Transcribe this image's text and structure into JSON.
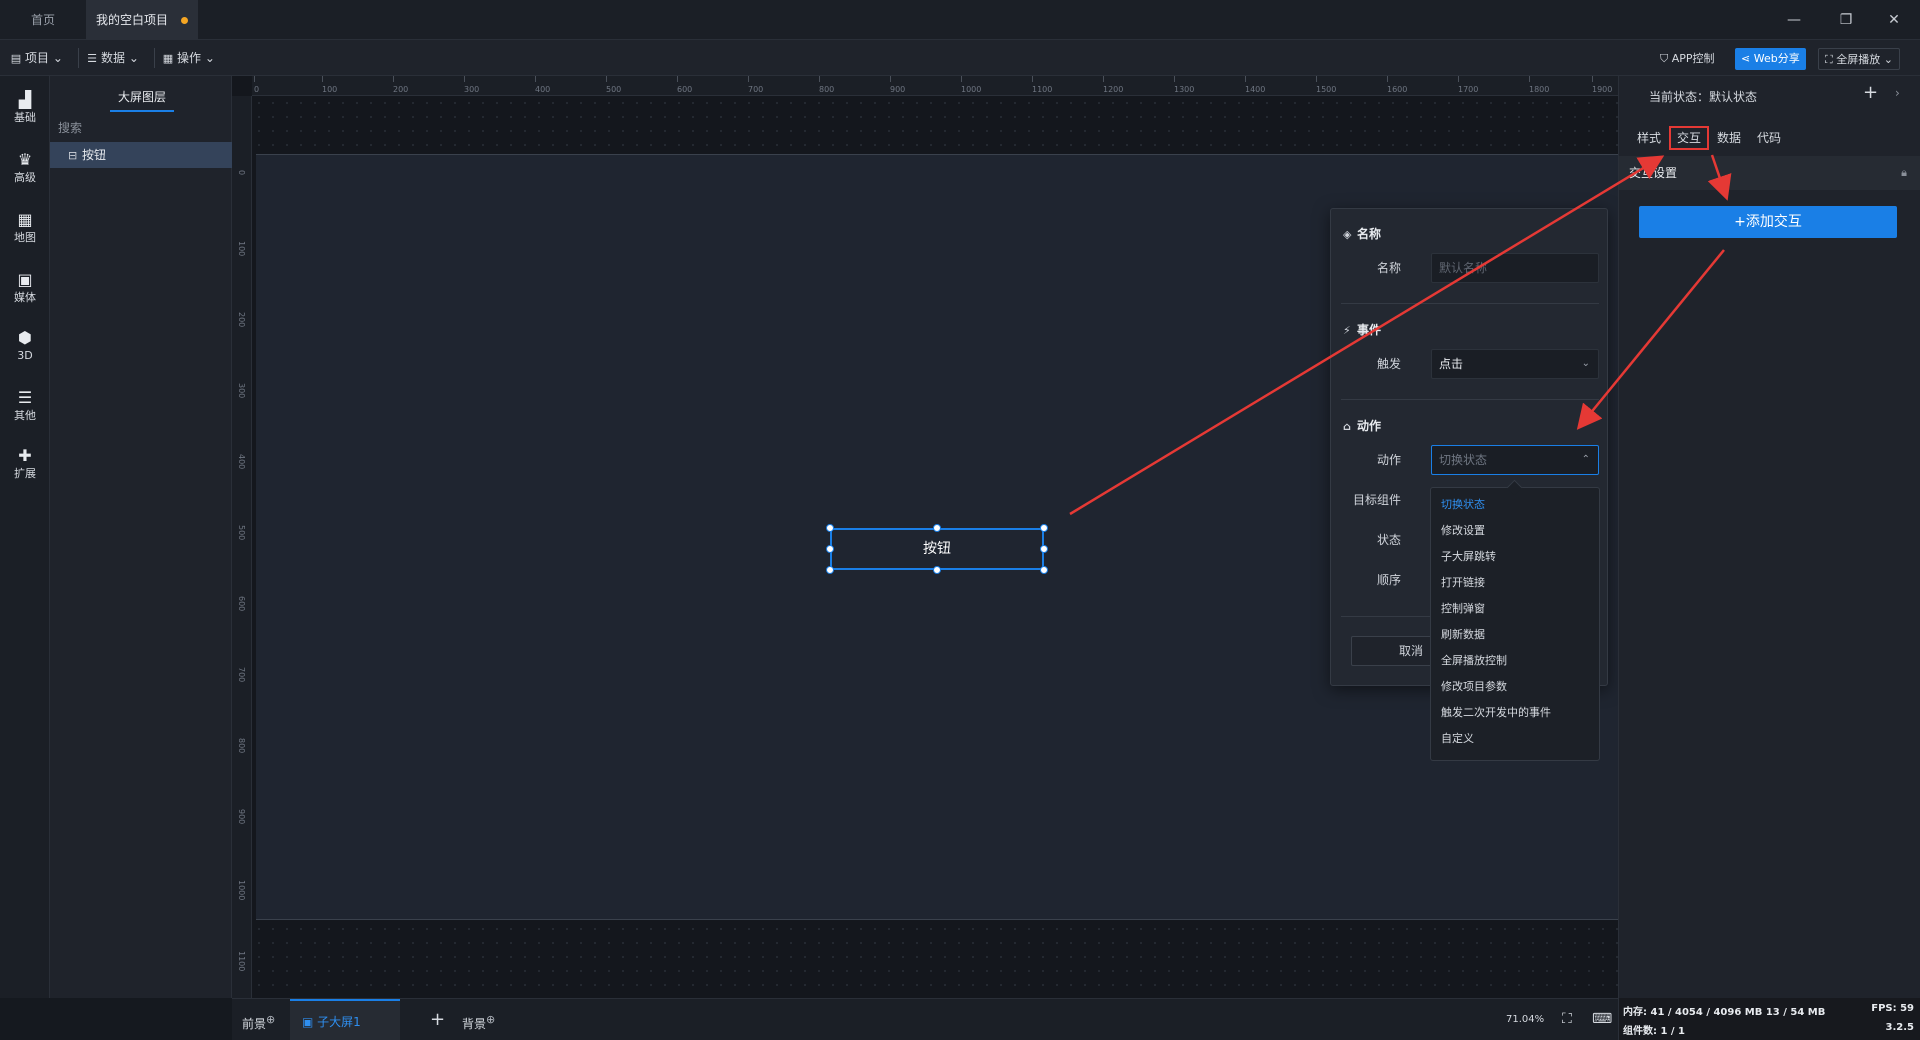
{
  "titlebar": {
    "home_tab": "首页",
    "project_tab": "我的空白项目",
    "minimize": "—",
    "restore": "❐",
    "close": "✕"
  },
  "toolbar": {
    "menus": [
      {
        "label": "项目",
        "icon": "file-icon"
      },
      {
        "label": "数据",
        "icon": "database-icon"
      },
      {
        "label": "操作",
        "icon": "grid-icon"
      }
    ],
    "app_control": "APP控制",
    "web_share": "Web分享",
    "fullscreen": "全屏播放"
  },
  "rail": [
    {
      "label": "基础",
      "icon": "bar-chart-icon",
      "glyph": "▟"
    },
    {
      "label": "高级",
      "icon": "crown-icon",
      "glyph": "♛"
    },
    {
      "label": "地图",
      "icon": "map-icon",
      "glyph": "▦"
    },
    {
      "label": "媒体",
      "icon": "media-icon",
      "glyph": "▣"
    },
    {
      "label": "3D",
      "icon": "cube-icon",
      "glyph": "⬢"
    },
    {
      "label": "其他",
      "icon": "list-icon",
      "glyph": "☰"
    },
    {
      "label": "扩展",
      "icon": "puzzle-icon",
      "glyph": "✚"
    }
  ],
  "layers": {
    "title": "大屏图层",
    "search": "搜索",
    "items": [
      {
        "label": "按钮",
        "icon": "button-icon"
      }
    ]
  },
  "ruler": {
    "h_ticks": [
      "0",
      "100",
      "200",
      "300",
      "400",
      "500",
      "600",
      "700",
      "800",
      "900",
      "1000",
      "1100",
      "1200",
      "1300",
      "1400",
      "1500",
      "1600",
      "1700",
      "1800",
      "1900"
    ],
    "v_ticks": [
      "0",
      "100",
      "200",
      "300",
      "400",
      "500",
      "600",
      "700",
      "800",
      "900",
      "1000",
      "1100"
    ]
  },
  "canvas": {
    "component_label": "按钮"
  },
  "dialog": {
    "name_section": "名称",
    "name_label": "名称",
    "name_placeholder": "默认名称",
    "event_section": "事件",
    "trigger_label": "触发",
    "trigger_value": "点击",
    "action_section": "动作",
    "action_label": "动作",
    "action_placeholder": "切换状态",
    "target_label": "目标组件",
    "state_label": "状态",
    "order_label": "顺序",
    "cancel": "取消"
  },
  "dropdown": {
    "options": [
      "切换状态",
      "修改设置",
      "子大屏跳转",
      "打开链接",
      "控制弹窗",
      "刷新数据",
      "全屏播放控制",
      "修改项目参数",
      "触发二次开发中的事件",
      "自定义"
    ],
    "selected": 0
  },
  "rpanel": {
    "state": "当前状态：默认状态",
    "tabs": [
      "样式",
      "交互",
      "数据",
      "代码"
    ],
    "active_tab": 1,
    "section": "交互设置",
    "add_button": "+添加交互"
  },
  "bottombar": {
    "foreground": "前景",
    "sub_screen": "子大屏1",
    "background": "背景",
    "zoom": "71.04%"
  },
  "status": {
    "memory": "内存: 41 / 4054 / 4096 MB  13 / 54 MB",
    "fps": "FPS: 59",
    "components": "组件数: 1 / 1",
    "version": "3.2.5"
  },
  "colors": {
    "accent": "#1a7fe6",
    "annotation": "#e53935",
    "unsaved_dot": "#f5a623"
  }
}
